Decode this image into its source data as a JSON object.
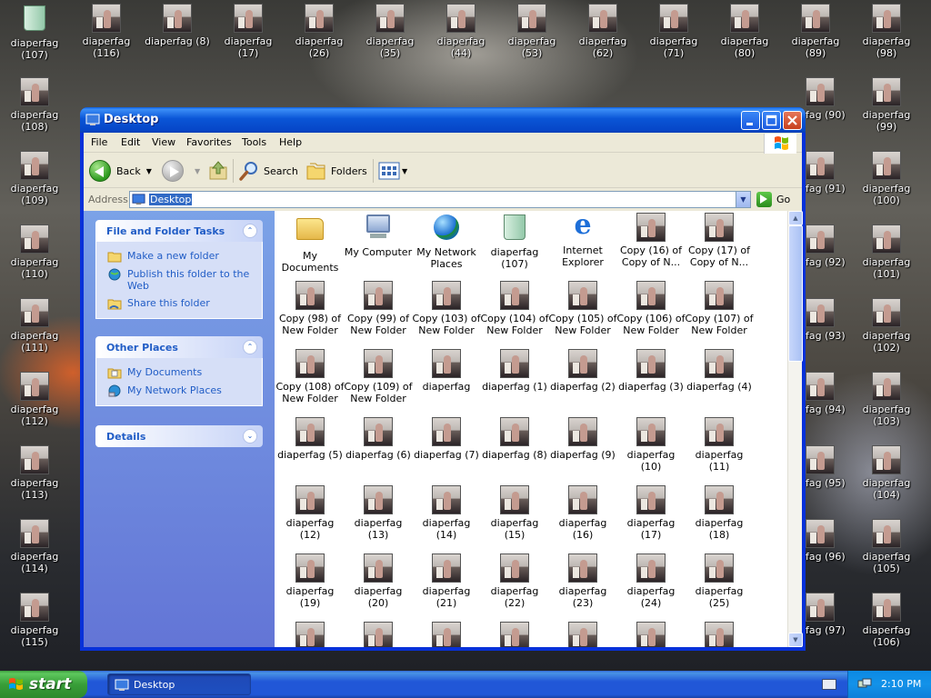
{
  "window": {
    "title": "Desktop",
    "menu": [
      "File",
      "Edit",
      "View",
      "Favorites",
      "Tools",
      "Help"
    ],
    "toolbar": {
      "back": "Back",
      "search": "Search",
      "folders": "Folders"
    },
    "address": {
      "label": "Address",
      "value": "Desktop",
      "go": "Go"
    }
  },
  "sidepanel": {
    "file_tasks": {
      "title": "File and Folder Tasks",
      "items": [
        "Make a new folder",
        "Publish this folder to the Web",
        "Share this folder"
      ]
    },
    "other_places": {
      "title": "Other Places",
      "items": [
        "My Documents",
        "My Network Places"
      ]
    },
    "details": {
      "title": "Details"
    }
  },
  "content": {
    "row0": [
      {
        "label": "My Documents",
        "icon": "folder-icon"
      },
      {
        "label": "My Computer",
        "icon": "computer-icon"
      },
      {
        "label": "My Network Places",
        "icon": "globe-icon"
      },
      {
        "label": "diaperfag (107)",
        "icon": "recycle-bin-icon"
      },
      {
        "label": "Internet Explorer",
        "icon": "ie-icon"
      },
      {
        "label": "Copy (16) of Copy of N...",
        "icon": "photo-thumbnail"
      },
      {
        "label": "Copy (17) of Copy of N...",
        "icon": "photo-thumbnail"
      }
    ],
    "row1": [
      "Copy (98) of New Folder",
      "Copy (99) of New Folder",
      "Copy (103) of New Folder",
      "Copy (104) of New Folder",
      "Copy (105) of New Folder",
      "Copy (106) of New Folder",
      "Copy (107) of New Folder"
    ],
    "row2": [
      "Copy (108) of New Folder",
      "Copy (109) of New Folder",
      "diaperfag",
      "diaperfag (1)",
      "diaperfag (2)",
      "diaperfag (3)",
      "diaperfag (4)"
    ],
    "row3": [
      "diaperfag (5)",
      "diaperfag (6)",
      "diaperfag (7)",
      "diaperfag (8)",
      "diaperfag (9)",
      "diaperfag (10)",
      "diaperfag (11)"
    ],
    "row4": [
      "diaperfag (12)",
      "diaperfag (13)",
      "diaperfag (14)",
      "diaperfag (15)",
      "diaperfag (16)",
      "diaperfag (17)",
      "diaperfag (18)"
    ],
    "row5": [
      "diaperfag (19)",
      "diaperfag (20)",
      "diaperfag (21)",
      "diaperfag (22)",
      "diaperfag (23)",
      "diaperfag (24)",
      "diaperfag (25)"
    ]
  },
  "desktop": {
    "top_row": [
      "diaperfag (107)",
      "diaperfag (116)",
      "diaperfag (8)",
      "diaperfag (17)",
      "diaperfag (26)",
      "diaperfag (35)",
      "diaperfag (44)",
      "diaperfag (53)",
      "diaperfag (62)",
      "diaperfag (71)",
      "diaperfag (80)",
      "diaperfag (89)",
      "diaperfag (98)"
    ],
    "left_col": [
      "diaperfag (108)",
      "diaperfag (109)",
      "diaperfag (110)",
      "diaperfag (111)",
      "diaperfag (112)",
      "diaperfag (113)",
      "diaperfag (114)",
      "diaperfag (115)"
    ],
    "partial_col": [
      "fag (90)",
      "fag (91)",
      "fag (92)",
      "fag (93)",
      "fag (94)",
      "fag (95)",
      "fag (96)",
      "fag (97)"
    ],
    "right_col": [
      "diaperfag (99)",
      "diaperfag (100)",
      "diaperfag (101)",
      "diaperfag (102)",
      "diaperfag (103)",
      "diaperfag (104)",
      "diaperfag (105)",
      "diaperfag (106)"
    ]
  },
  "taskbar": {
    "start": "start",
    "task": "Desktop",
    "clock": "2:10 PM"
  }
}
